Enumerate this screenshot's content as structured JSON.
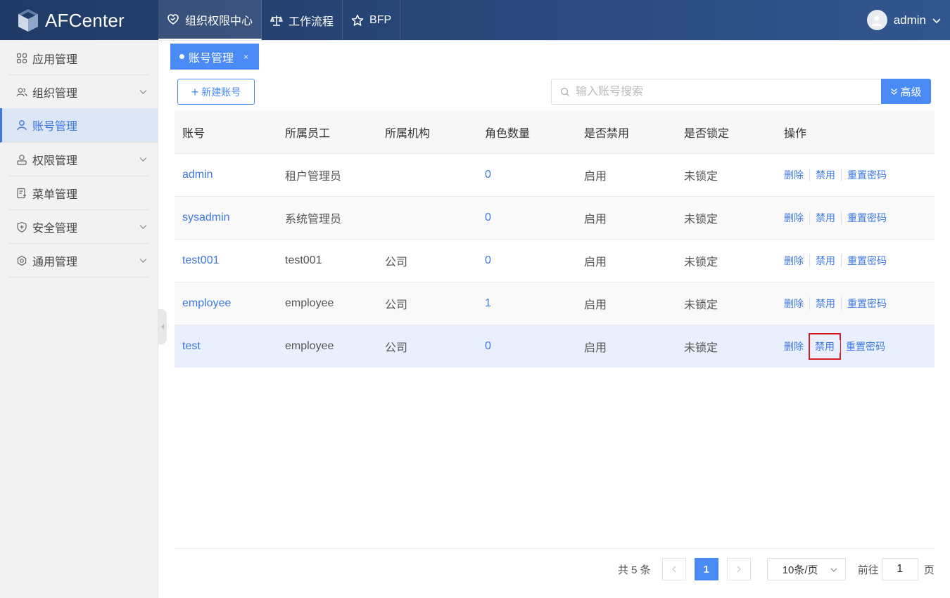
{
  "header": {
    "app_name": "AFCenter",
    "nav": [
      {
        "label": "组织权限中心",
        "icon": "heart-shield-icon",
        "active": true
      },
      {
        "label": "工作流程",
        "icon": "balance-scale-icon",
        "active": false
      },
      {
        "label": "BFP",
        "icon": "star-icon",
        "active": false
      }
    ],
    "user": {
      "name": "admin"
    }
  },
  "sidebar": {
    "items": [
      {
        "label": "应用管理",
        "icon": "apps-grid-icon",
        "has_arrow": false,
        "active": false
      },
      {
        "label": "组织管理",
        "icon": "group-users-icon",
        "has_arrow": true,
        "active": false
      },
      {
        "label": "账号管理",
        "icon": "user-icon",
        "has_arrow": false,
        "active": true
      },
      {
        "label": "权限管理",
        "icon": "user-key-icon",
        "has_arrow": true,
        "active": false
      },
      {
        "label": "菜单管理",
        "icon": "menu-doc-icon",
        "has_arrow": false,
        "active": false
      },
      {
        "label": "安全管理",
        "icon": "shield-plus-icon",
        "has_arrow": true,
        "active": false
      },
      {
        "label": "通用管理",
        "icon": "settings-ring-icon",
        "has_arrow": true,
        "active": false
      }
    ]
  },
  "tabs": [
    {
      "label": "账号管理",
      "close": "×"
    }
  ],
  "toolbar": {
    "new_label": "新建账号",
    "search_placeholder": "输入账号搜索",
    "advanced_label": "高级"
  },
  "table": {
    "columns": [
      "账号",
      "所属员工",
      "所属机构",
      "角色数量",
      "是否禁用",
      "是否锁定",
      "操作"
    ],
    "rows": [
      {
        "account": "admin",
        "employee": "租户管理员",
        "org": "",
        "roles": "0",
        "disabled": "启用",
        "locked": "未锁定"
      },
      {
        "account": "sysadmin",
        "employee": "系统管理员",
        "org": "",
        "roles": "0",
        "disabled": "启用",
        "locked": "未锁定"
      },
      {
        "account": "test001",
        "employee": "test001",
        "org": "公司",
        "roles": "0",
        "disabled": "启用",
        "locked": "未锁定"
      },
      {
        "account": "employee",
        "employee": "employee",
        "org": "公司",
        "roles": "1",
        "disabled": "启用",
        "locked": "未锁定"
      },
      {
        "account": "test",
        "employee": "employee",
        "org": "公司",
        "roles": "0",
        "disabled": "启用",
        "locked": "未锁定"
      }
    ],
    "actions": [
      "删除",
      "禁用",
      "重置密码"
    ]
  },
  "pagination": {
    "total_text": "共 5 条",
    "current_page": "1",
    "page_size": "10条/页",
    "goto_label": "前往",
    "goto_value": "1",
    "page_suffix": "页"
  },
  "colors": {
    "primary": "#4a8af4",
    "header_bg": "#2b4a7e",
    "highlight_box": "#d81e25"
  }
}
